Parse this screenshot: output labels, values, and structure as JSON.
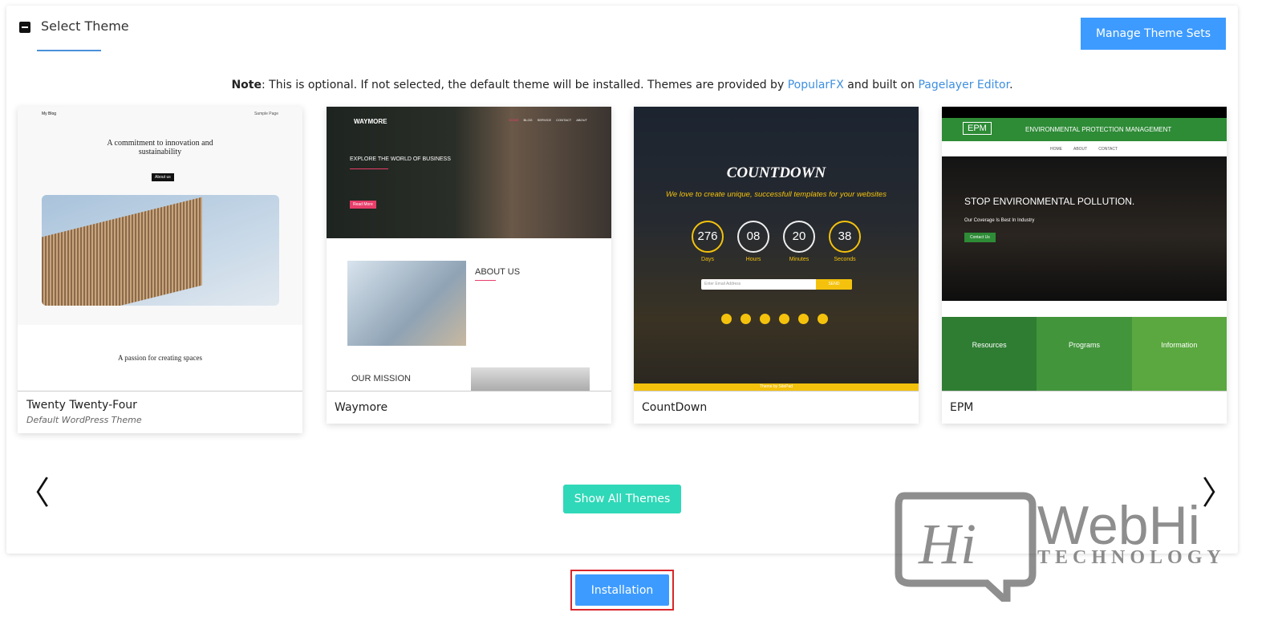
{
  "header": {
    "title": "Select Theme",
    "manage_label": "Manage Theme Sets"
  },
  "note": {
    "bold": "Note",
    "text1": ": This is optional. If not selected, the default theme will be installed. Themes are provided by ",
    "link1": "PopularFX",
    "text2": " and built on ",
    "link2": "Pagelayer Editor",
    "text3": "."
  },
  "themes": [
    {
      "name": "Twenty Twenty-Four",
      "subtitle": "Default WordPress Theme",
      "preview": {
        "brand": "My Blog",
        "nav": "Sample Page",
        "headline": "A commitment to innovation and sustainability",
        "button": "About us",
        "footer_title": "A passion for creating spaces"
      }
    },
    {
      "name": "Waymore",
      "preview": {
        "brand": "WAYMORE",
        "nav": [
          "HOME",
          "BLOG",
          "SERVICE",
          "CONTACT",
          "ABOUT"
        ],
        "headline": "EXPLORE THE WORLD OF BUSINESS",
        "button": "Read More",
        "section": "ABOUT US",
        "section2": "OUR MISSION"
      }
    },
    {
      "name": "CountDown",
      "preview": {
        "title": "COUNTDOWN",
        "tagline": "We love to create unique, successfull templates for your websites",
        "counters": [
          {
            "value": "276",
            "label": "Days"
          },
          {
            "value": "08",
            "label": "Hours"
          },
          {
            "value": "20",
            "label": "Minutes"
          },
          {
            "value": "38",
            "label": "Seconds"
          }
        ],
        "email_placeholder": "Enter Email Address",
        "send": "SEND",
        "footer": "Theme by SitePad"
      }
    },
    {
      "name": "EPM",
      "preview": {
        "logo": "EPM",
        "title": "ENVIRONMENTAL PROTECTION MANAGEMENT",
        "nav": [
          "HOME",
          "ABOUT",
          "CONTACT"
        ],
        "headline": "STOP ENVIRONMENTAL POLLUTION.",
        "sub": "Our Coverage Is Best In Industry",
        "button": "Contact Us",
        "columns": [
          "Resources",
          "Programs",
          "Information"
        ]
      }
    }
  ],
  "show_all_label": "Show All Themes",
  "install_label": "Installation",
  "watermark": {
    "text": "WebHi",
    "sub": "TECHNOLOGY",
    "logo": "Hi"
  },
  "colors": {
    "primary": "#3d9bff",
    "teal": "#2fd8b8",
    "highlight": "#d9262b",
    "link": "#3d8fe0"
  }
}
